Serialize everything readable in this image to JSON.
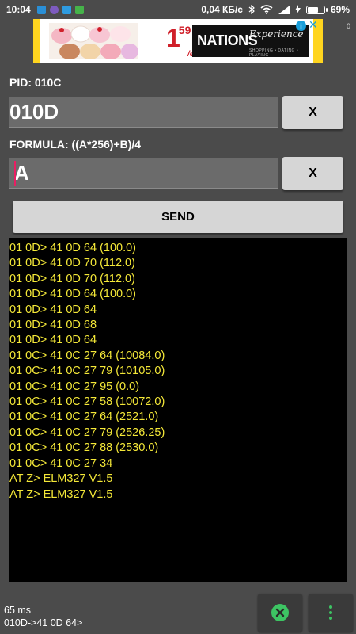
{
  "status_bar": {
    "time": "10:04",
    "net_speed": "0,04 КБ/с",
    "battery": "69%",
    "battery_level": 0.69
  },
  "ad": {
    "price_main": "1",
    "price_cents": "59",
    "price_unit": "/ea",
    "brand": "NATIONS",
    "brand_script": "Experience",
    "brand_tagline": "SHOPPING • DATING • PLAYING",
    "info_icon": "i",
    "close_icon": "✕",
    "counter": "0"
  },
  "pid": {
    "label": "PID: 010C",
    "value": "010D",
    "clear_label": "X"
  },
  "formula": {
    "label": "FORMULA: ((A*256)+B)/4",
    "value": "A",
    "clear_label": "X"
  },
  "send_label": "SEND",
  "console_lines": [
    "01 0D> 41 0D 64 (100.0)",
    "01 0D> 41 0D 70 (112.0)",
    "01 0D> 41 0D 70 (112.0)",
    "01 0D> 41 0D 64 (100.0)",
    "01 0D> 41 0D 64",
    "01 0D> 41 0D 68",
    "01 0D> 41 0D 64",
    "01 0C> 41 0C 27 64 (10084.0)",
    "01 0C> 41 0C 27 79 (10105.0)",
    "01 0C> 41 0C 27 95 (0.0)",
    "01 0C> 41 0C 27 58 (10072.0)",
    "01 0C> 41 0C 27 64 (2521.0)",
    "01 0C> 41 0C 27 79 (2526.25)",
    "01 0C> 41 0C 27 88 (2530.0)",
    "01 0C> 41 0C 27 34",
    "AT Z> ELM327 V1.5",
    "AT Z> ELM327 V1.5"
  ],
  "footer": {
    "timing": "65 ms",
    "last_response": "010D->41 0D 64>"
  },
  "colors": {
    "console_text": "#f4e838",
    "accent_green": "#3dc463",
    "cursor_pink": "#e91e63"
  }
}
